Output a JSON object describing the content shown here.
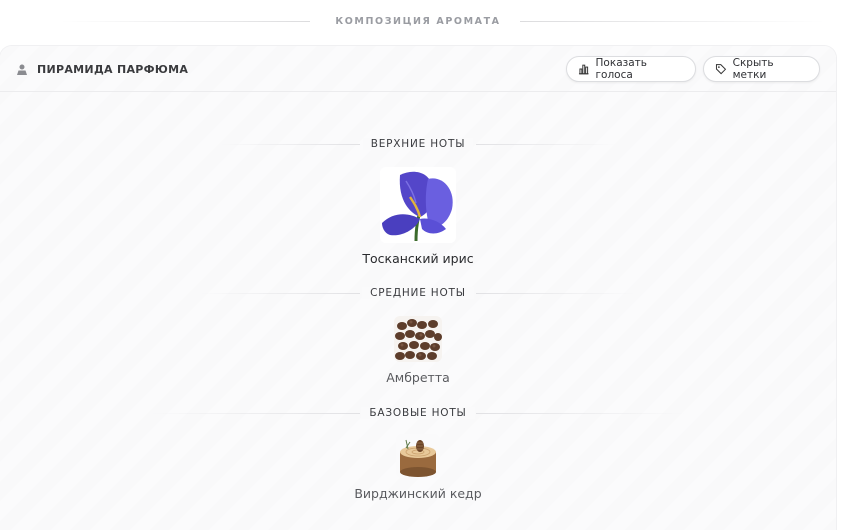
{
  "section": {
    "title": "КОМПОЗИЦИЯ АРОМАТА"
  },
  "card": {
    "title": "ПИРАМИДА ПАРФЮМА",
    "title_icon": "pyramid-person-icon",
    "buttons": [
      {
        "label": "Показать голоса",
        "icon": "bar-chart-icon"
      },
      {
        "label": "Скрыть метки",
        "icon": "tag-icon"
      }
    ]
  },
  "tiers": [
    {
      "label": "ВЕРХНИЕ НОТЫ",
      "notes": [
        {
          "name": "Тосканский ирис",
          "image": "iris-flower"
        }
      ]
    },
    {
      "label": "СРЕДНИЕ НОТЫ",
      "notes": [
        {
          "name": "Амбретта",
          "image": "ambrette-seeds"
        }
      ]
    },
    {
      "label": "БАЗОВЫЕ НОТЫ",
      "notes": [
        {
          "name": "Вирджинский кедр",
          "image": "cedar-wood-slice"
        }
      ]
    }
  ],
  "colors": {
    "accent_text": "#3a3b3e",
    "muted": "#9a9ca2",
    "iris": "#5b4fd0"
  }
}
